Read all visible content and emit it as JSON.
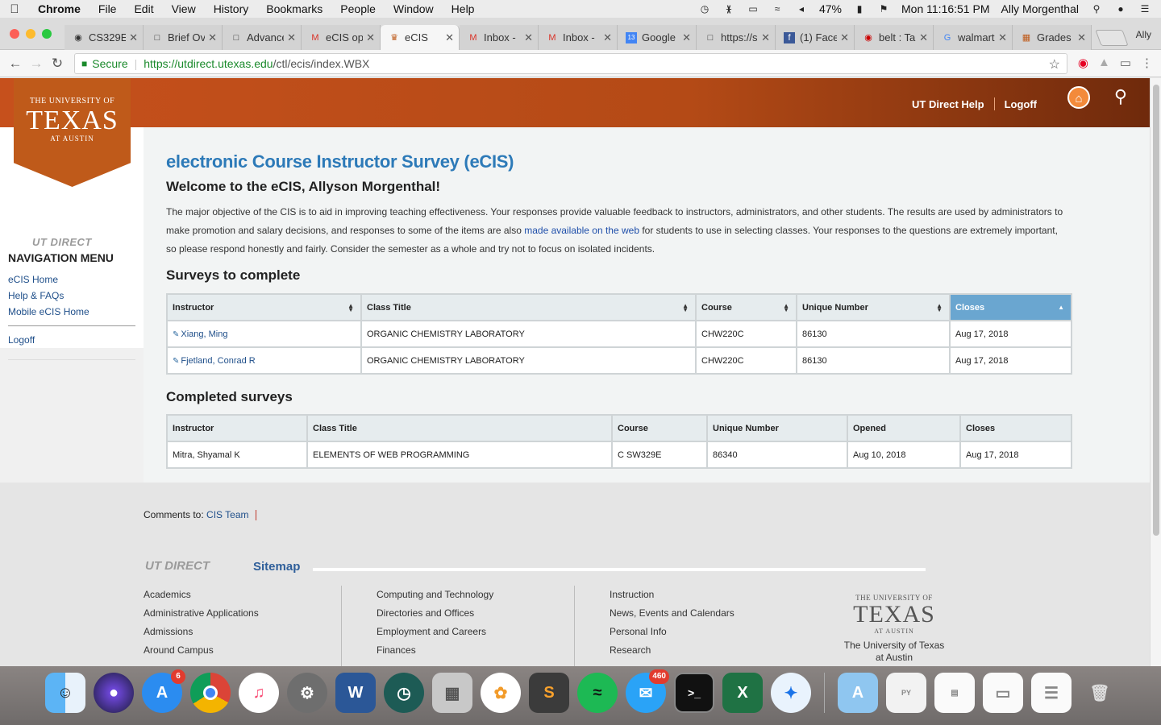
{
  "menubar": {
    "app": "Chrome",
    "items": [
      "File",
      "Edit",
      "View",
      "History",
      "Bookmarks",
      "People",
      "Window",
      "Help"
    ],
    "battery": "47%",
    "clock": "Mon 11:16:51 PM",
    "user": "Ally Morgenthal"
  },
  "browser": {
    "tabs": [
      {
        "title": "CS329E",
        "icon": "github-icon"
      },
      {
        "title": "Brief Ov",
        "icon": "page-icon"
      },
      {
        "title": "Advance",
        "icon": "page-icon"
      },
      {
        "title": "eCIS op",
        "icon": "gmail-icon"
      },
      {
        "title": "eCIS",
        "icon": "ut-icon",
        "active": true
      },
      {
        "title": "Inbox -",
        "icon": "gmail-icon"
      },
      {
        "title": "Inbox -",
        "icon": "gmail-icon"
      },
      {
        "title": "Google",
        "icon": "calendar-icon"
      },
      {
        "title": "https://s",
        "icon": "page-icon"
      },
      {
        "title": "(1) Face",
        "icon": "facebook-icon"
      },
      {
        "title": "belt : Ta",
        "icon": "target-icon"
      },
      {
        "title": "walmart",
        "icon": "google-icon"
      },
      {
        "title": "Grades",
        "icon": "canvas-icon"
      }
    ],
    "profile_label": "Ally",
    "secure_label": "Secure",
    "url_host": "https://utdirect.utexas.edu",
    "url_path": "/ctl/ecis/index.WBX"
  },
  "header": {
    "banner_line1": "THE UNIVERSITY OF",
    "banner_line2": "TEXAS",
    "banner_line3": "AT AUSTIN",
    "help_link": "UT Direct Help",
    "logoff_link": "Logoff"
  },
  "sidebar": {
    "logo_text": "UT DIRECT",
    "title": "NAVIGATION MENU",
    "links": [
      "eCIS Home",
      "Help & FAQs",
      "Mobile eCIS Home"
    ],
    "logoff": "Logoff"
  },
  "main": {
    "title": "electronic Course Instructor Survey (eCIS)",
    "welcome": "Welcome to the eCIS, Allyson Morgenthal!",
    "intro_part1": "The major objective of the CIS is to aid in improving teaching effectiveness. Your responses provide valuable feedback to instructors, administrators, and other students. The results are used by administrators to make promotion and salary decisions, and responses to some of the items are also ",
    "intro_link": "made available on the web",
    "intro_part2": " for students to use in selecting classes. Your responses to the questions are extremely important, so please respond honestly and fairly. Consider the semester as a whole and try not to focus on isolated incidents.",
    "surveys_heading": "Surveys to complete",
    "surveys_columns": [
      "Instructor",
      "Class Title",
      "Course",
      "Unique Number",
      "Closes"
    ],
    "surveys_rows": [
      {
        "instructor": "Xiang, Ming",
        "title": "ORGANIC CHEMISTRY LABORATORY",
        "course": "CHW220C",
        "unique": "86130",
        "closes": "Aug 17, 2018"
      },
      {
        "instructor": "Fjetland, Conrad R",
        "title": "ORGANIC CHEMISTRY LABORATORY",
        "course": "CHW220C",
        "unique": "86130",
        "closes": "Aug 17, 2018"
      }
    ],
    "completed_heading": "Completed surveys",
    "completed_columns": [
      "Instructor",
      "Class Title",
      "Course",
      "Unique Number",
      "Opened",
      "Closes"
    ],
    "completed_rows": [
      {
        "instructor": "Mitra, Shyamal K",
        "title": "ELEMENTS OF WEB PROGRAMMING",
        "course": "C SW329E",
        "unique": "86340",
        "opened": "Aug 10, 2018",
        "closes": "Aug 17, 2018"
      }
    ]
  },
  "footer": {
    "comments_label": "Comments to:",
    "comments_link": "CIS Team",
    "sitemap_logo": "UT DIRECT",
    "sitemap_title": "Sitemap",
    "col1": [
      "Academics",
      "Administrative Applications",
      "Admissions",
      "Around Campus"
    ],
    "col2": [
      "Computing and Technology",
      "Directories and Offices",
      "Employment and Careers",
      "Finances"
    ],
    "col3": [
      "Instruction",
      "News, Events and Calendars",
      "Personal Info",
      "Research"
    ],
    "ut_line1": "THE UNIVERSITY OF",
    "ut_line2": "TEXAS",
    "ut_line3": "AT AUSTIN",
    "ut_caption1": "The University of Texas",
    "ut_caption2": "at Austin"
  },
  "dock": {
    "appstore_badge": "6",
    "messages_badge": "460"
  },
  "colors": {
    "ut_orange": "#bf5a1a",
    "title_blue": "#2d7ab8",
    "sorted_header": "#6aa6d0"
  }
}
